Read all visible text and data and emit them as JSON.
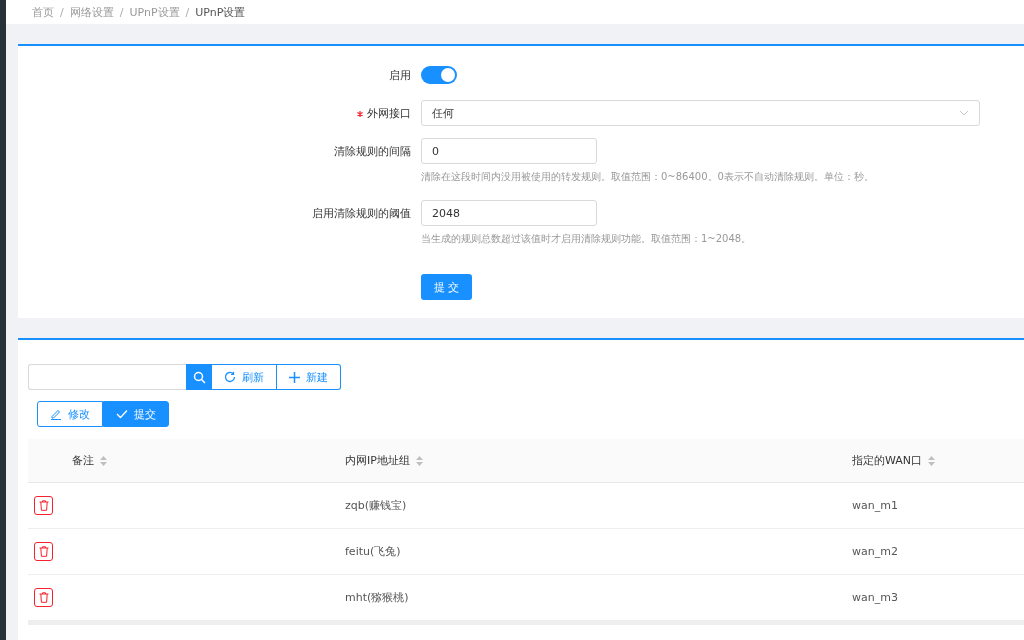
{
  "breadcrumb": [
    "首页",
    "网络设置",
    "UPnP设置",
    "UPnP设置"
  ],
  "breadcrumb_separator": "/",
  "form": {
    "enable": {
      "label": "启用",
      "on": true
    },
    "wan_interface": {
      "label": "外网接口",
      "required": true,
      "value": "任何"
    },
    "clear_interval": {
      "label": "清除规则的间隔",
      "value": "0",
      "hint": "清除在这段时间内没用被使用的转发规则。取值范围：0~86400。0表示不自动清除规则。单位：秒。"
    },
    "clear_threshold": {
      "label": "启用清除规则的阈值",
      "value": "2048",
      "hint": "当生成的规则总数超过该值时才启用清除规则功能。取值范围：1~2048。"
    },
    "submit": "提 交"
  },
  "toolbar": {
    "refresh": "刷新",
    "new": "新建",
    "edit": "修改",
    "submit": "提交"
  },
  "table": {
    "columns": [
      "备注",
      "内网IP地址组",
      "指定的WAN口"
    ],
    "rows": [
      {
        "ip_group": "zqb(赚钱宝)",
        "wan": "wan_m1"
      },
      {
        "ip_group": "feitu(飞兔)",
        "wan": "wan_m2"
      },
      {
        "ip_group": "mht(猕猴桃)",
        "wan": "wan_m3"
      }
    ]
  }
}
